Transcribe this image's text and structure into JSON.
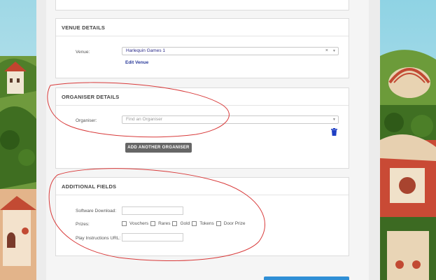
{
  "venue": {
    "heading": "VENUE DETAILS",
    "label": "Venue:",
    "value": "Harlequin Games 1",
    "clear_symbol": "×",
    "caret_symbol": "▼",
    "edit_link": "Edit Venue"
  },
  "organiser": {
    "heading": "ORGANISER DETAILS",
    "label": "Organiser:",
    "placeholder": "Find an Organiser",
    "caret_symbol": "▼",
    "add_button": "ADD ANOTHER ORGANISER",
    "delete_icon": "trash-icon"
  },
  "additional": {
    "heading": "ADDITIONAL FIELDS",
    "software_label": "Software Download:",
    "prizes_label": "Prizes:",
    "prize_options": [
      "Vouchers",
      "Rares",
      "Gold",
      "Tokens",
      "Door Prize"
    ],
    "play_label": "Play Instructions URL:"
  },
  "colors": {
    "annotation": "#d83a3a",
    "link": "#2b3b9a",
    "primary": "#2f8fd6",
    "delete": "#1f3fc4"
  }
}
